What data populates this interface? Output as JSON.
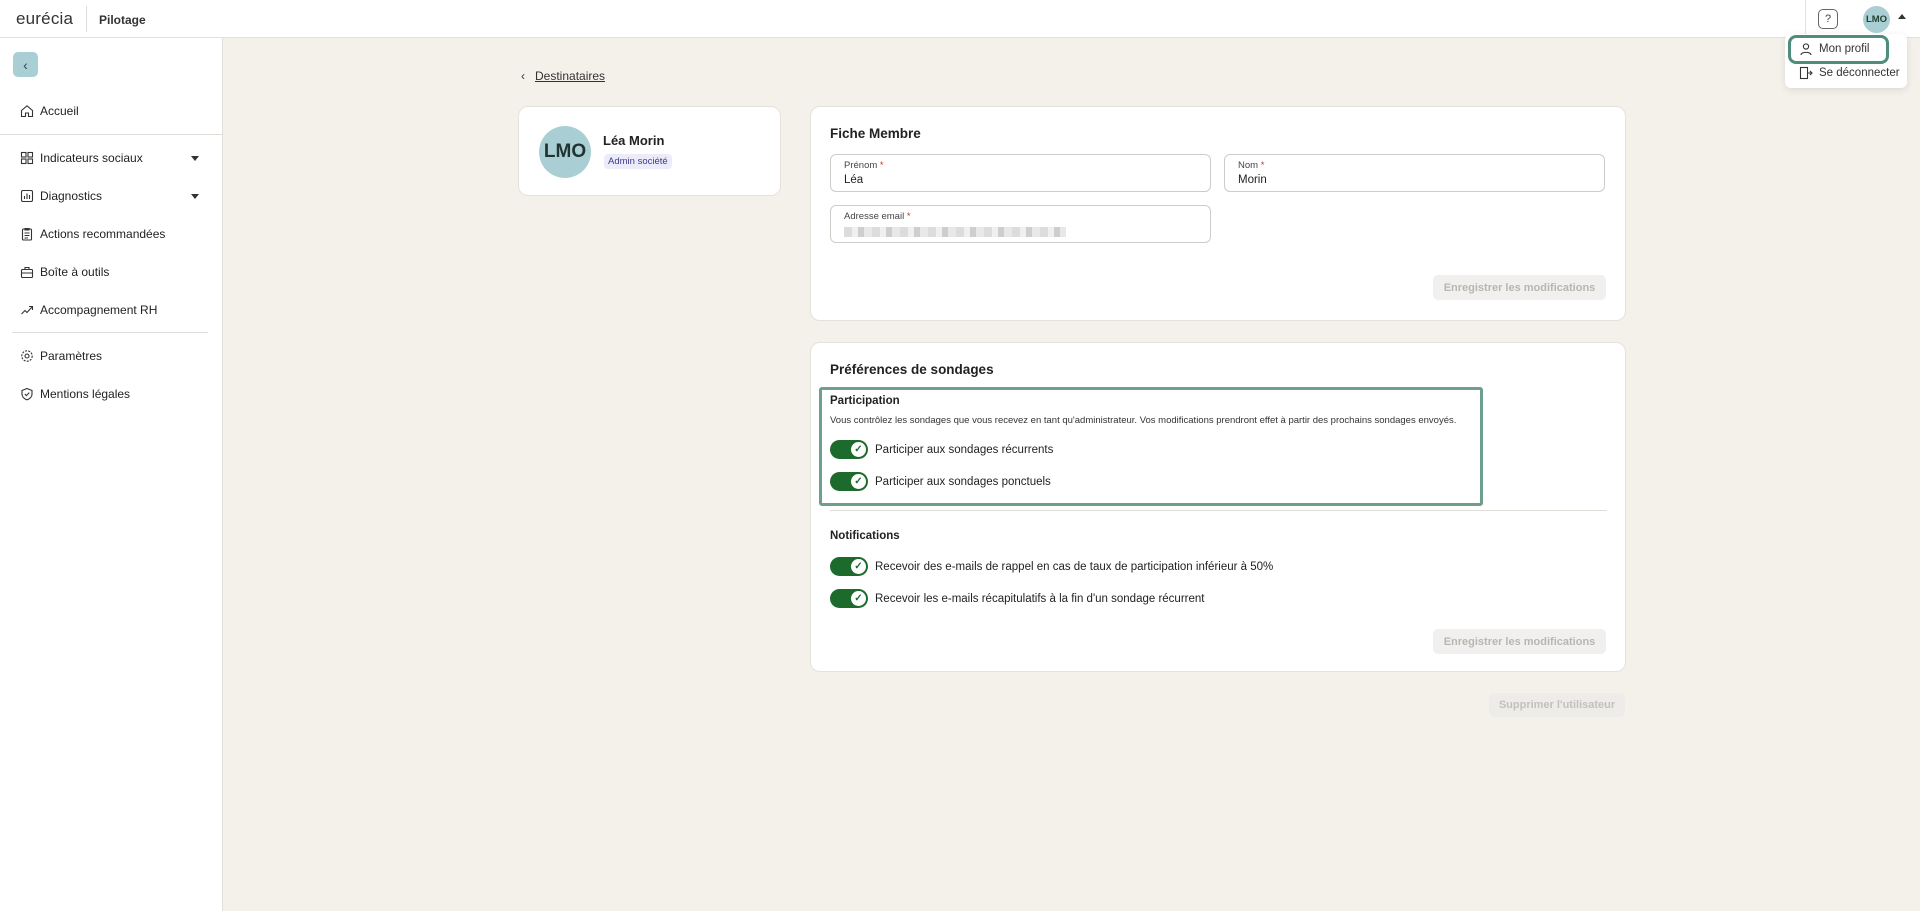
{
  "header": {
    "logo": "eurécia",
    "app_title": "Pilotage",
    "help_icon": "question-icon",
    "user_initials": "LMO"
  },
  "user_menu": {
    "items": [
      {
        "label": "Mon profil",
        "icon": "user-icon"
      },
      {
        "label": "Se déconnecter",
        "icon": "logout-icon"
      }
    ]
  },
  "sidebar": {
    "back_icon": "chevron-left-icon",
    "items": [
      {
        "label": "Accueil",
        "icon": "home-icon"
      },
      {
        "label": "Indicateurs sociaux",
        "icon": "grid-icon",
        "expandable": true
      },
      {
        "label": "Diagnostics",
        "icon": "bar-chart-icon",
        "expandable": true
      },
      {
        "label": "Actions recommandées",
        "icon": "clipboard-icon"
      },
      {
        "label": "Boîte à outils",
        "icon": "toolbox-icon"
      },
      {
        "label": "Accompagnement RH",
        "icon": "handshake-icon"
      },
      {
        "label": "Paramètres",
        "icon": "gear-icon"
      },
      {
        "label": "Mentions légales",
        "icon": "shield-icon"
      }
    ]
  },
  "breadcrumb": {
    "link": "Destinataires"
  },
  "profile": {
    "initials": "LMO",
    "name": "Léa Morin",
    "role_badge": "Admin société"
  },
  "member_form": {
    "title": "Fiche Membre",
    "prenom_label": "Prénom",
    "prenom_value": "Léa",
    "nom_label": "Nom",
    "nom_value": "Morin",
    "email_label": "Adresse email",
    "required_mark": "*",
    "save_label": "Enregistrer les modifications"
  },
  "preferences": {
    "title": "Préférences de sondages",
    "participation": {
      "title": "Participation",
      "description": "Vous contrôlez les sondages que vous recevez en tant qu'administrateur. Vos modifications prendront effet à partir des prochains sondages envoyés.",
      "toggles": [
        {
          "label": "Participer aux sondages récurrents",
          "on": true
        },
        {
          "label": "Participer aux sondages ponctuels",
          "on": true
        }
      ]
    },
    "notifications": {
      "title": "Notifications",
      "toggles": [
        {
          "label": "Recevoir des e-mails de rappel en cas de taux de participation inférieur à 50%",
          "on": true
        },
        {
          "label": "Recevoir les e-mails récapitulatifs à la fin d'un sondage récurrent",
          "on": true
        }
      ]
    },
    "save_label": "Enregistrer les modifications"
  },
  "delete_user_label": "Supprimer l'utilisateur",
  "colors": {
    "accent_toggle": "#1c6b2c",
    "avatar_bg": "#a9cfd4",
    "highlight": "#6e9e8c",
    "page_bg": "#f4f1eb"
  }
}
